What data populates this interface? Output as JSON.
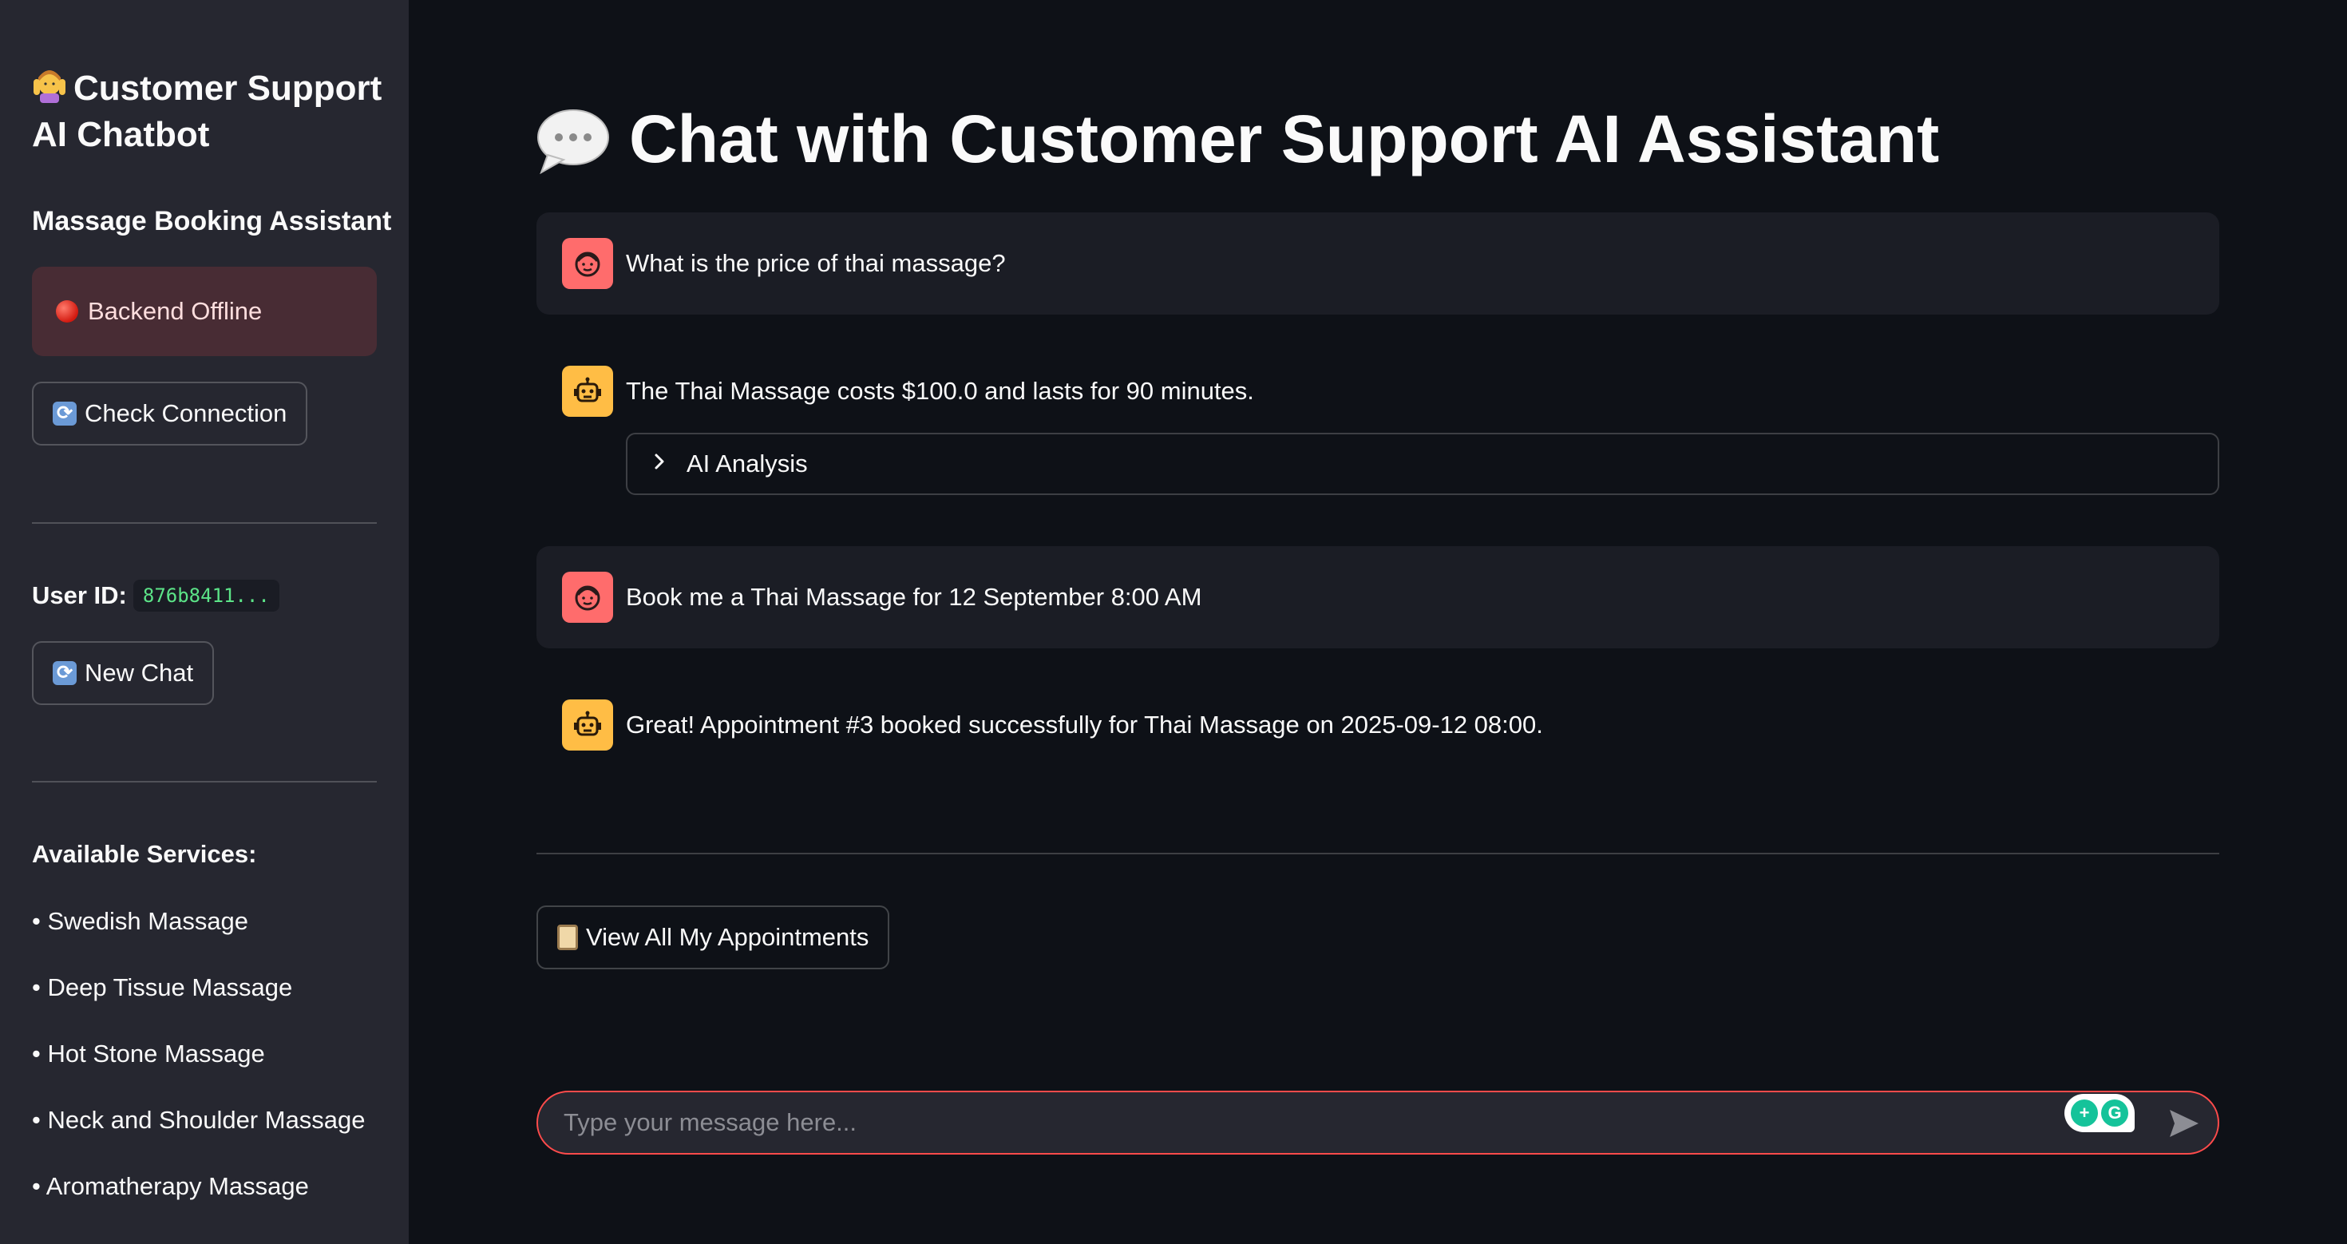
{
  "sidebar": {
    "title": "Customer Support AI Chatbot",
    "subtitle": "Massage Booking Assistant",
    "status": "Backend Offline",
    "check_connection": "Check Connection",
    "user_id_label": "User ID:",
    "user_id_value": "876b8411...",
    "new_chat": "New Chat",
    "services_heading": "Available Services:",
    "services": [
      "• Swedish Massage",
      "• Deep Tissue Massage",
      "• Hot Stone Massage",
      "• Neck and Shoulder Massage",
      "• Aromatherapy Massage"
    ]
  },
  "main": {
    "title": "Chat with Customer Support AI Assistant",
    "messages": [
      {
        "role": "user",
        "text": "What is the price of thai massage?"
      },
      {
        "role": "assistant",
        "text": "The Thai Massage costs $100.0 and lasts for 90 minutes."
      },
      {
        "role": "user",
        "text": "Book me a Thai Massage for 12 September 8:00 AM"
      },
      {
        "role": "assistant",
        "text": "Great! Appointment #3 booked successfully for Thai Massage on 2025-09-12 08:00."
      }
    ],
    "expander_label": "AI Analysis",
    "view_appointments": "View All My Appointments",
    "input_placeholder": "Type your message here..."
  },
  "colors": {
    "background": "#0e1117",
    "sidebar": "#262730",
    "accent": "#ff4b4b",
    "user_avatar": "#ff6c6c",
    "bot_avatar": "#ffbd45"
  }
}
